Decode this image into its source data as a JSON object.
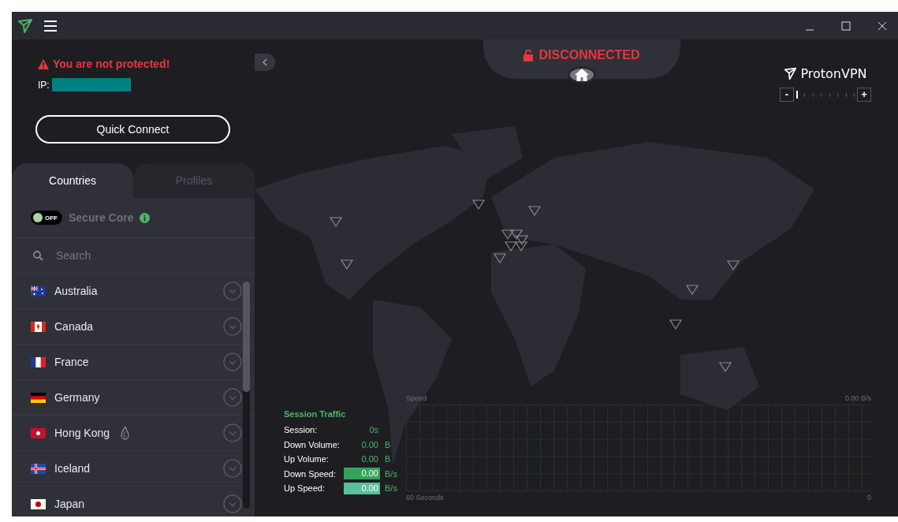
{
  "status": {
    "warning": "You are not protected!",
    "ip_label": "IP:"
  },
  "quick_connect": "Quick Connect",
  "tabs": [
    {
      "label": "Countries",
      "selected": true
    },
    {
      "label": "Profiles",
      "selected": false
    }
  ],
  "secure_core": {
    "label": "Secure Core",
    "toggle_text": "OFF",
    "on": false
  },
  "search": {
    "placeholder": "Search"
  },
  "countries": [
    {
      "name": "Australia",
      "kind": "au",
      "tor": false
    },
    {
      "name": "Canada",
      "kind": "ca",
      "tor": false
    },
    {
      "name": "France",
      "kind": "fr",
      "tor": false
    },
    {
      "name": "Germany",
      "kind": "de",
      "tor": false
    },
    {
      "name": "Hong Kong",
      "kind": "hk",
      "tor": true
    },
    {
      "name": "Iceland",
      "kind": "is",
      "tor": false
    },
    {
      "name": "Japan",
      "kind": "jp",
      "tor": false
    }
  ],
  "connection": {
    "status": "DISCONNECTED"
  },
  "brand": "ProtonVPN",
  "zoom": {
    "minus": "-",
    "plus": "+",
    "level": 0
  },
  "session_traffic": {
    "title": "Session Traffic",
    "rows": [
      {
        "label": "Session:",
        "value": "0s",
        "unit": "",
        "kind": "plain"
      },
      {
        "label": "Down Volume:",
        "value": "0.00",
        "unit": "B",
        "kind": "plain"
      },
      {
        "label": "Up Volume:",
        "value": "0.00",
        "unit": "B",
        "kind": "plain"
      },
      {
        "label": "Down Speed:",
        "value": "0.00",
        "unit": "B/s",
        "kind": "down"
      },
      {
        "label": "Up Speed:",
        "value": "0.00",
        "unit": "B/s",
        "kind": "up"
      }
    ]
  },
  "speed_chart": {
    "title": "Speed",
    "max": "0.00 B/s",
    "x_start": "60 Seconds",
    "x_end": "0"
  }
}
